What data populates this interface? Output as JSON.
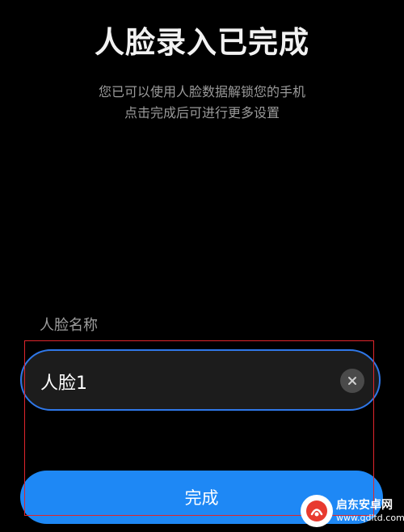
{
  "header": {
    "title": "人脸录入已完成",
    "subtitle_line1": "您已可以使用人脸数据解锁您的手机",
    "subtitle_line2": "点击完成后可进行更多设置"
  },
  "face_name_field": {
    "label": "人脸名称",
    "value": "人脸1",
    "clear_icon": "close-circle-icon"
  },
  "done_button": {
    "label": "完成"
  },
  "watermark": {
    "name": "启东安卓网",
    "url": "www.qdltd.com"
  },
  "colors": {
    "background": "#000000",
    "accent_blue": "#1e88f5",
    "input_border": "#2f77e8",
    "annotation_red": "#e0262c"
  }
}
